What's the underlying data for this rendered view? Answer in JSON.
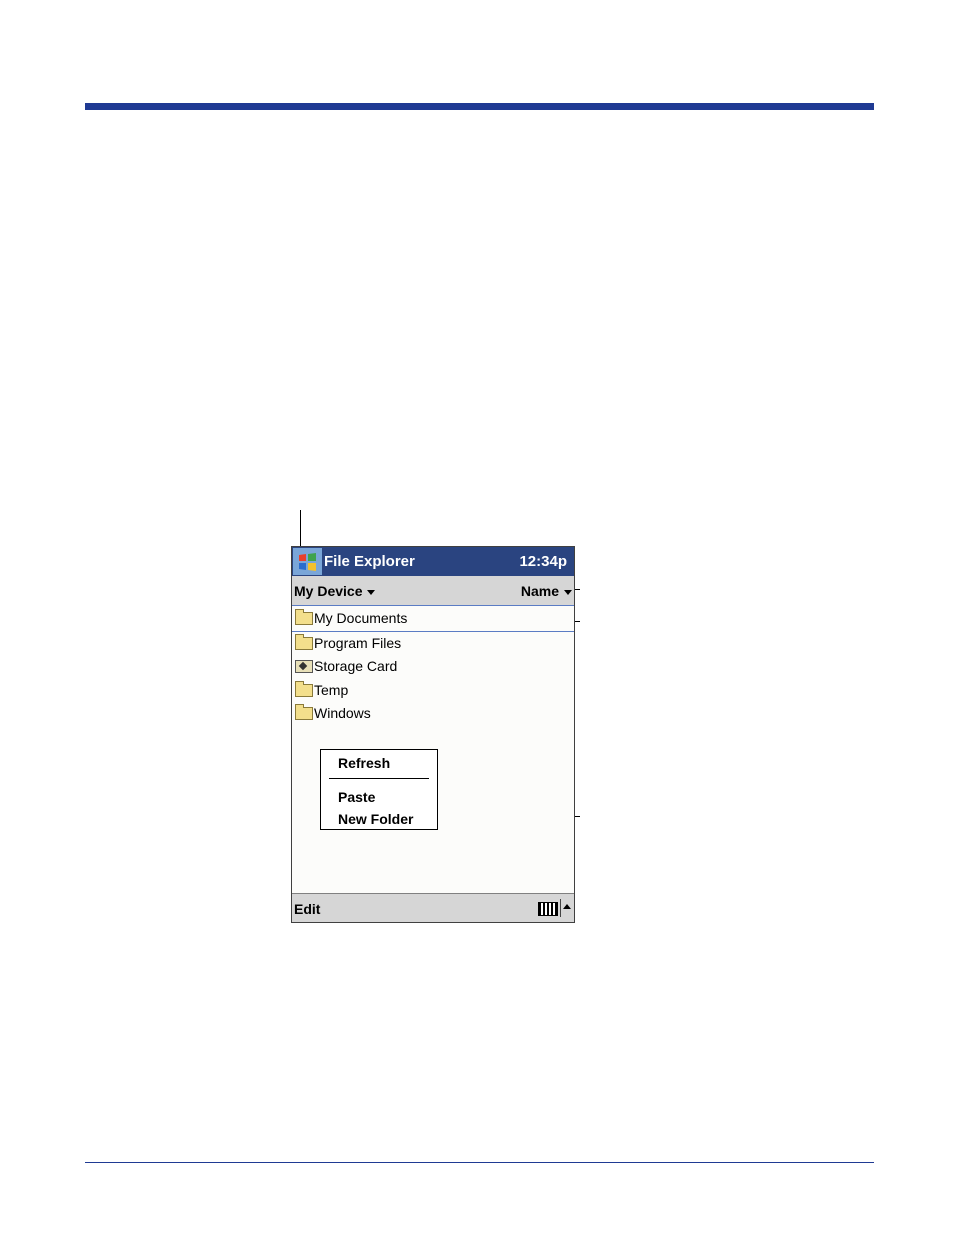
{
  "device": {
    "app_title": "File Explorer",
    "clock": "12:34p",
    "location": "My Device",
    "sort": "Name",
    "files": [
      {
        "name": "My Documents",
        "icon": "folder-icon"
      },
      {
        "name": "Program Files",
        "icon": "folder-icon"
      },
      {
        "name": "Storage Card",
        "icon": "storage-card-icon"
      },
      {
        "name": "Temp",
        "icon": "folder-icon"
      },
      {
        "name": "Windows",
        "icon": "folder-icon"
      }
    ],
    "context_menu": {
      "refresh": "Refresh",
      "paste": "Paste",
      "new_folder": "New Folder"
    },
    "command_bar": {
      "edit": "Edit"
    }
  },
  "colors": {
    "accent": "#1f3a93",
    "titlebar": "#2a4480"
  }
}
